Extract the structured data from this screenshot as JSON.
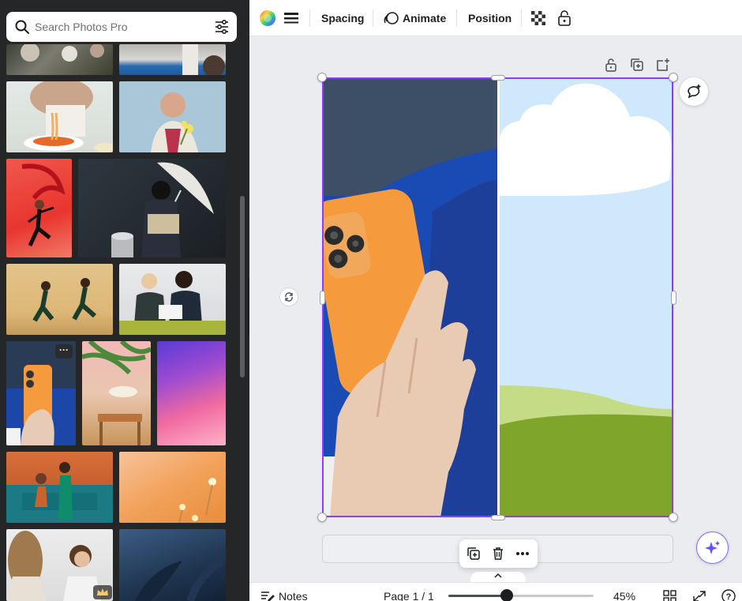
{
  "search": {
    "placeholder": "Search Photos Pro"
  },
  "toolbar": {
    "spacing_label": "Spacing",
    "animate_label": "Animate",
    "position_label": "Position"
  },
  "photo_grid": {
    "items": [
      {
        "name": "photo-food-plates"
      },
      {
        "name": "photo-sink-blue"
      },
      {
        "name": "photo-pasta-eating"
      },
      {
        "name": "photo-elder-flowers"
      },
      {
        "name": "photo-dancer-red"
      },
      {
        "name": "photo-kimono-umbrella"
      },
      {
        "name": "photo-kids-running"
      },
      {
        "name": "photo-two-women-laptop"
      },
      {
        "name": "photo-phone-hand"
      },
      {
        "name": "photo-cafe-plants"
      },
      {
        "name": "photo-gradient-purple"
      },
      {
        "name": "photo-office-couple"
      },
      {
        "name": "photo-orange-flowers"
      },
      {
        "name": "photo-women-talking"
      },
      {
        "name": "photo-dark-leaves"
      }
    ],
    "more_label": "···"
  },
  "footer": {
    "notes_label": "Notes",
    "page_label": "Page 1 / 1",
    "zoom_label": "45%",
    "zoom_value": 0.4
  },
  "colors": {
    "selection": "#8b3dff",
    "sky": "#cfe8fb",
    "grass": "#7fa52a",
    "jacket": "#1c47a8",
    "phone": "#f59b3d"
  }
}
